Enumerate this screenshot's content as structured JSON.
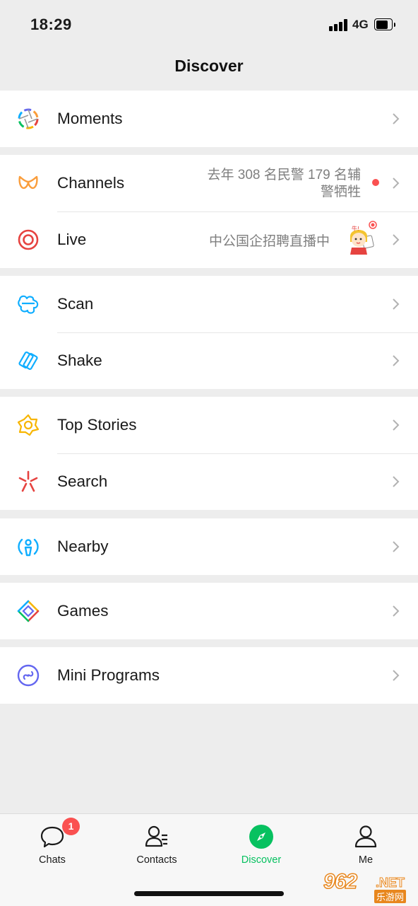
{
  "status_bar": {
    "time": "18:29",
    "network": "4G"
  },
  "nav": {
    "title": "Discover"
  },
  "groups": {
    "moments": {
      "label": "Moments"
    },
    "channels": {
      "label": "Channels",
      "subtext": "去年 308 名民警 179 名辅警牺牲"
    },
    "live": {
      "label": "Live",
      "subtext": "中公国企招聘直播中"
    },
    "scan": {
      "label": "Scan"
    },
    "shake": {
      "label": "Shake"
    },
    "top_stories": {
      "label": "Top Stories"
    },
    "search": {
      "label": "Search"
    },
    "nearby": {
      "label": "Nearby"
    },
    "games": {
      "label": "Games"
    },
    "mini_programs": {
      "label": "Mini Programs"
    }
  },
  "tabbar": {
    "tabs": [
      {
        "label": "Chats",
        "badge": "1"
      },
      {
        "label": "Contacts"
      },
      {
        "label": "Discover",
        "active": true
      },
      {
        "label": "Me"
      }
    ]
  },
  "watermark": {
    "number": "962",
    "suffix": ".NET",
    "site": "乐游网"
  },
  "colors": {
    "accent": "#07c160",
    "badge": "#fa5151",
    "background": "#ededed"
  }
}
